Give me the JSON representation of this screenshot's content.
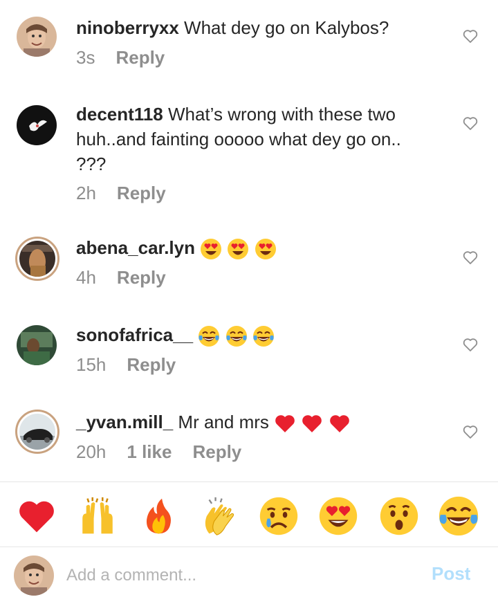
{
  "comments": [
    {
      "username": "ninoberryxx",
      "text": " What dey go on Kalybos?",
      "time": "3s",
      "likes": "",
      "reply": "Reply"
    },
    {
      "username": "decent118",
      "text": " What’s wrong with these two huh..and fainting ooooo what dey go on.. ???",
      "time": "2h",
      "likes": "",
      "reply": "Reply"
    },
    {
      "username": "abena_car.lyn",
      "text": "",
      "time": "4h",
      "likes": "",
      "reply": "Reply"
    },
    {
      "username": "sonofafrica__",
      "text": "",
      "time": "15h",
      "likes": "",
      "reply": "Reply"
    },
    {
      "username": "_yvan.mill_",
      "text": " Mr and mrs",
      "time": "20h",
      "likes": "1 like",
      "reply": "Reply"
    }
  ],
  "reactions": [
    "red-heart",
    "raising-hands",
    "fire",
    "clapping-hands",
    "sad-relieved-face",
    "heart-eyes-face",
    "astonished-face",
    "tears-of-joy-face"
  ],
  "composer": {
    "placeholder": "Add a comment...",
    "post_label": "Post"
  }
}
